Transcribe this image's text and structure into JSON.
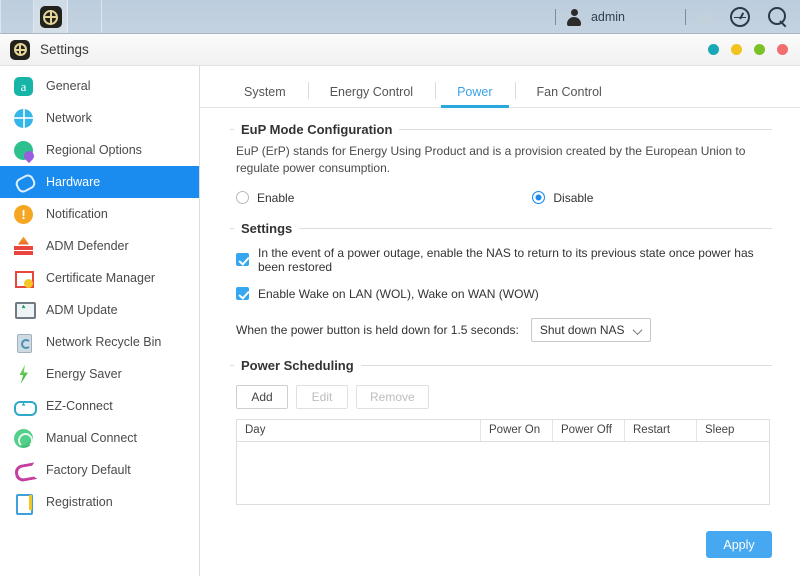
{
  "desktop": {
    "taskbar": {
      "app_icon": "settings-gear-icon"
    },
    "topbar": {
      "user_icon": "user-icon",
      "user_name": "admin",
      "bell_icon": "bell-icon",
      "dashboard_icon": "dashboard-gauge-icon",
      "search_icon": "search-icon"
    }
  },
  "window": {
    "icon": "settings-gear-icon",
    "title": "Settings",
    "buttons": [
      {
        "name": "pin",
        "color": "#1aa8b8"
      },
      {
        "name": "minimize",
        "color": "#f2c21e"
      },
      {
        "name": "maximize",
        "color": "#7ac126"
      },
      {
        "name": "close",
        "color": "#f26d6d"
      }
    ]
  },
  "sidebar": {
    "items": [
      {
        "label": "General",
        "icon": "general-icon",
        "active": false
      },
      {
        "label": "Network",
        "icon": "network-globe-icon",
        "active": false
      },
      {
        "label": "Regional Options",
        "icon": "regional-options-icon",
        "active": false
      },
      {
        "label": "Hardware",
        "icon": "hardware-icon",
        "active": true
      },
      {
        "label": "Notification",
        "icon": "notification-icon",
        "active": false
      },
      {
        "label": "ADM Defender",
        "icon": "adm-defender-firewall-icon",
        "active": false
      },
      {
        "label": "Certificate Manager",
        "icon": "certificate-manager-icon",
        "active": false
      },
      {
        "label": "ADM Update",
        "icon": "adm-update-icon",
        "active": false
      },
      {
        "label": "Network Recycle Bin",
        "icon": "network-recycle-bin-icon",
        "active": false
      },
      {
        "label": "Energy Saver",
        "icon": "energy-saver-bolt-icon",
        "active": false
      },
      {
        "label": "EZ-Connect",
        "icon": "ez-connect-cloud-icon",
        "active": false
      },
      {
        "label": "Manual Connect",
        "icon": "manual-connect-icon",
        "active": false
      },
      {
        "label": "Factory Default",
        "icon": "factory-default-undo-icon",
        "active": false
      },
      {
        "label": "Registration",
        "icon": "registration-icon",
        "active": false
      }
    ]
  },
  "tabs": [
    {
      "label": "System",
      "active": false
    },
    {
      "label": "Energy Control",
      "active": false
    },
    {
      "label": "Power",
      "active": true
    },
    {
      "label": "Fan Control",
      "active": false
    }
  ],
  "eup_section": {
    "legend": "EuP Mode Configuration",
    "description": "EuP (ErP) stands for Energy Using Product and is a provision created by the European Union to regulate power consumption.",
    "options": [
      {
        "label": "Enable",
        "checked": false
      },
      {
        "label": "Disable",
        "checked": true
      }
    ]
  },
  "settings_section": {
    "legend": "Settings",
    "checkboxes": [
      {
        "label": "In the event of a power outage, enable the NAS to return to its previous state once power has been restored",
        "checked": true
      },
      {
        "label": "Enable Wake on LAN (WOL), Wake on WAN (WOW)",
        "checked": true
      }
    ],
    "power_button": {
      "label": "When the power button is held down for 1.5 seconds:",
      "selected": "Shut down NAS"
    }
  },
  "power_scheduling": {
    "legend": "Power Scheduling",
    "buttons": [
      {
        "label": "Add",
        "disabled": false
      },
      {
        "label": "Edit",
        "disabled": true
      },
      {
        "label": "Remove",
        "disabled": true
      }
    ],
    "table": {
      "columns": [
        "Day",
        "Power On",
        "Power Off",
        "Restart",
        "Sleep"
      ],
      "rows": []
    }
  },
  "footer": {
    "apply_label": "Apply"
  },
  "colors": {
    "accent_blue": "#1a8cf0",
    "apply_blue": "#45a8f0",
    "tab_active": "#3aa3e8",
    "tab_underline": "#29a8e0",
    "checkbox_blue": "#35a6ef"
  }
}
